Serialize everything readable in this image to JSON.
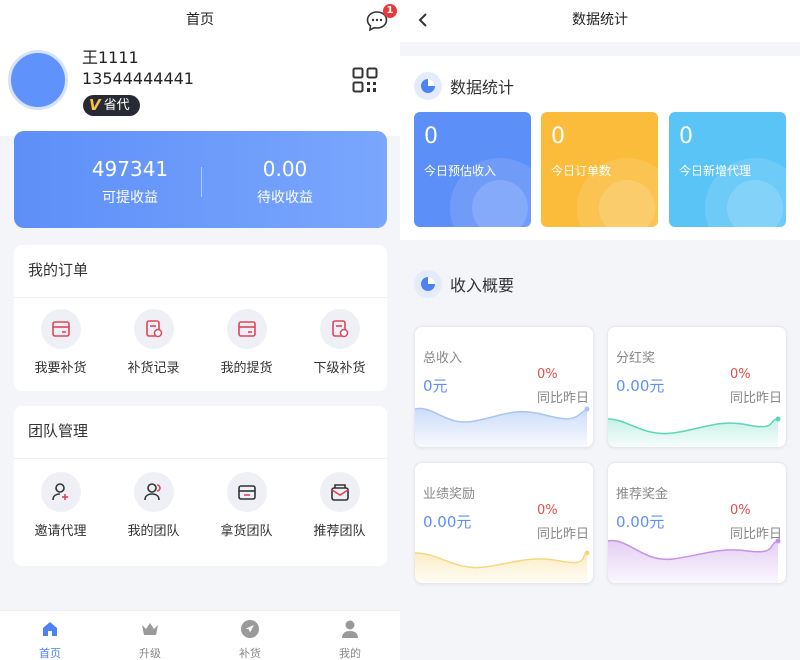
{
  "left": {
    "title": "首页",
    "notification_count": "1",
    "user": {
      "name": "王1111",
      "phone": "13544444441",
      "level": "省代",
      "level_prefix": "V"
    },
    "earnings": {
      "withdrawable_value": "497341",
      "withdrawable_label": "可提收益",
      "pending_value": "0.00",
      "pending_label": "待收收益"
    },
    "orders": {
      "title": "我的订单",
      "items": [
        {
          "label": "我要补货"
        },
        {
          "label": "补货记录"
        },
        {
          "label": "我的提货"
        },
        {
          "label": "下级补货"
        }
      ]
    },
    "team": {
      "title": "团队管理",
      "items": [
        {
          "label": "邀请代理"
        },
        {
          "label": "我的团队"
        },
        {
          "label": "拿货团队"
        },
        {
          "label": "推荐团队"
        }
      ]
    },
    "tabs": [
      {
        "label": "首页",
        "icon": "home-icon"
      },
      {
        "label": "升级",
        "icon": "crown-icon"
      },
      {
        "label": "补货",
        "icon": "send-icon"
      },
      {
        "label": "我的",
        "icon": "user-icon"
      }
    ]
  },
  "right": {
    "title": "数据统计",
    "stats_title": "数据统计",
    "stats": [
      {
        "value": "0",
        "label": "今日预估收入",
        "color": "#5d8ff8"
      },
      {
        "value": "0",
        "label": "今日订单数",
        "color": "#fbbc3b"
      },
      {
        "value": "0",
        "label": "今日新增代理",
        "color": "#5bc4f7"
      }
    ],
    "income_title": "收入概要",
    "income": [
      {
        "title": "总收入",
        "value": "0元",
        "percent": "0%",
        "compare": "同比昨日",
        "color": "#a9c4f5"
      },
      {
        "title": "分红奖",
        "value": "0.00元",
        "percent": "0%",
        "compare": "同比昨日",
        "color": "#5cd6b8"
      },
      {
        "title": "业绩奖励",
        "value": "0.00元",
        "percent": "0%",
        "compare": "同比昨日",
        "color": "#f7d77e"
      },
      {
        "title": "推荐奖金",
        "value": "0.00元",
        "percent": "0%",
        "compare": "同比昨日",
        "color": "#c592e8"
      }
    ]
  }
}
